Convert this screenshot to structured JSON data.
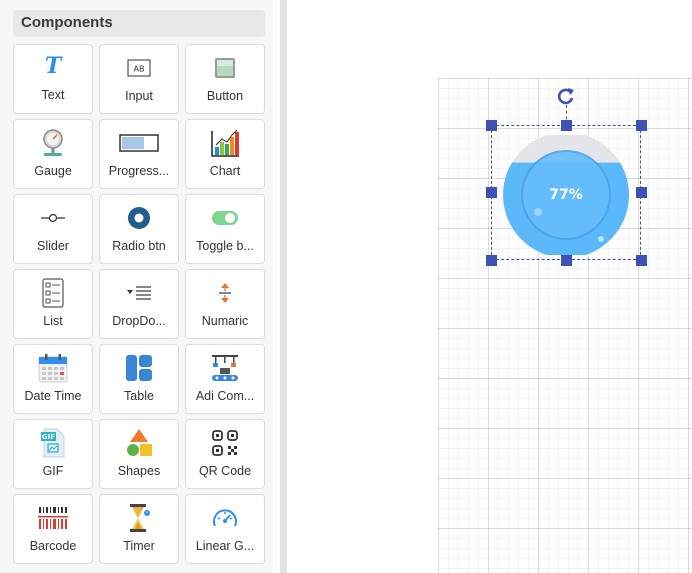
{
  "panel": {
    "title": "Components",
    "items": [
      {
        "label": "Text",
        "icon": "text-icon"
      },
      {
        "label": "Input",
        "icon": "input-icon"
      },
      {
        "label": "Button",
        "icon": "button-icon"
      },
      {
        "label": "Gauge",
        "icon": "gauge-icon"
      },
      {
        "label": "Progress...",
        "icon": "progress-icon"
      },
      {
        "label": "Chart",
        "icon": "chart-icon"
      },
      {
        "label": "Slider",
        "icon": "slider-icon"
      },
      {
        "label": "Radio btn",
        "icon": "radio-icon"
      },
      {
        "label": "Toggle b...",
        "icon": "toggle-icon"
      },
      {
        "label": "List",
        "icon": "list-icon"
      },
      {
        "label": "DropDo...",
        "icon": "dropdown-icon"
      },
      {
        "label": "Numaric",
        "icon": "numeric-icon"
      },
      {
        "label": "Date Time",
        "icon": "calendar-icon"
      },
      {
        "label": "Table",
        "icon": "table-icon"
      },
      {
        "label": "Adi Com...",
        "icon": "adi-component-icon"
      },
      {
        "label": "GIF",
        "icon": "gif-icon"
      },
      {
        "label": "Shapes",
        "icon": "shapes-icon"
      },
      {
        "label": "QR Code",
        "icon": "qr-code-icon"
      },
      {
        "label": "Barcode",
        "icon": "barcode-icon"
      },
      {
        "label": "Timer",
        "icon": "hourglass-icon"
      },
      {
        "label": "Linear G...",
        "icon": "speedometer-icon"
      }
    ]
  },
  "canvas": {
    "progress_widget": {
      "value_text": "77%",
      "fill_fraction": 0.77,
      "fill_color": "#5bb8fb",
      "track_color": "#e3e5e8"
    },
    "selection": {
      "color": "#3f51b5",
      "rotate_icon": "rotate-icon"
    }
  }
}
